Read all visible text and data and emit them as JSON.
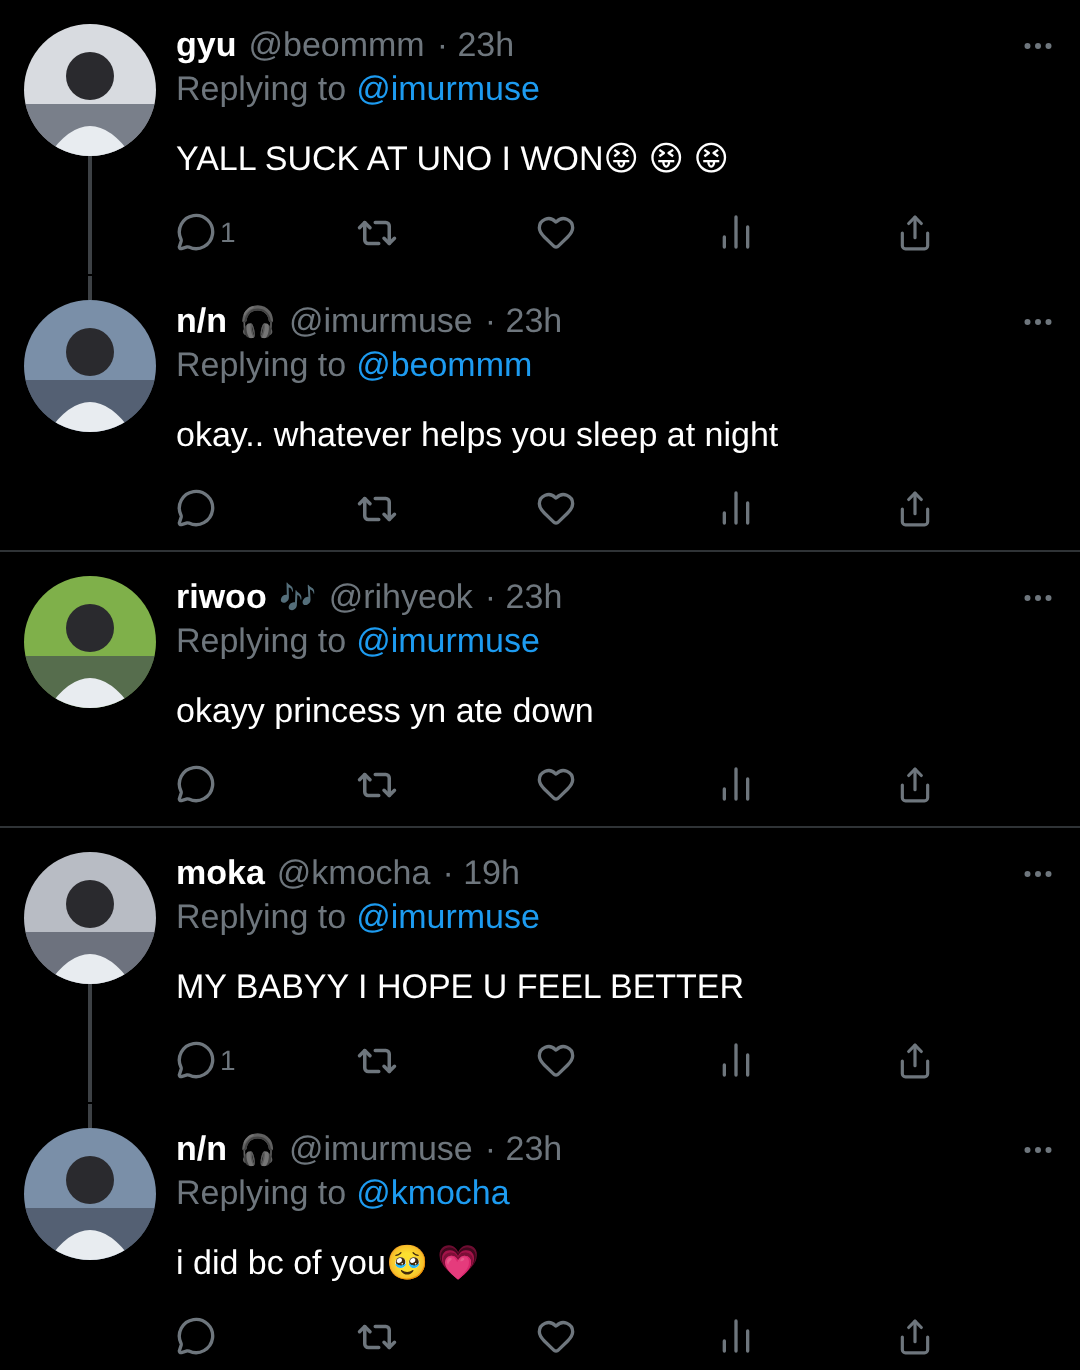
{
  "tweets": [
    {
      "name": "gyu",
      "handle": "@beommm",
      "time": "· 23h",
      "replying_label": "Replying to",
      "replying_to": "@imurmuse",
      "text": "YALL SUCK AT UNO I WON😝 😝 😝",
      "reply_count": "1",
      "thread_above": false,
      "thread_below": true,
      "divider": false
    },
    {
      "name": "n/n",
      "badge": "🎧",
      "handle": "@imurmuse",
      "time": "· 23h",
      "replying_label": "Replying to",
      "replying_to": "@beommm",
      "text": "okay.. whatever helps you sleep at night",
      "thread_above": true,
      "thread_below": false,
      "divider": true
    },
    {
      "name": "riwoo",
      "badge": "🎶",
      "handle": "@rihyeok",
      "time": "· 23h",
      "replying_label": "Replying to",
      "replying_to": "@imurmuse",
      "text": "okayy princess yn ate down",
      "thread_above": false,
      "thread_below": false,
      "divider": true
    },
    {
      "name": "moka",
      "handle": "@kmocha",
      "time": "· 19h",
      "replying_label": "Replying to",
      "replying_to": "@imurmuse",
      "text": "MY BABYY I HOPE U FEEL BETTER",
      "reply_count": "1",
      "thread_above": false,
      "thread_below": true,
      "divider": false
    },
    {
      "name": "n/n",
      "badge": "🎧",
      "handle": "@imurmuse",
      "time": "· 23h",
      "replying_label": "Replying to",
      "replying_to": "@kmocha",
      "text": "i did bc of you🥹 💗",
      "thread_above": true,
      "thread_below": false,
      "divider": false
    }
  ]
}
